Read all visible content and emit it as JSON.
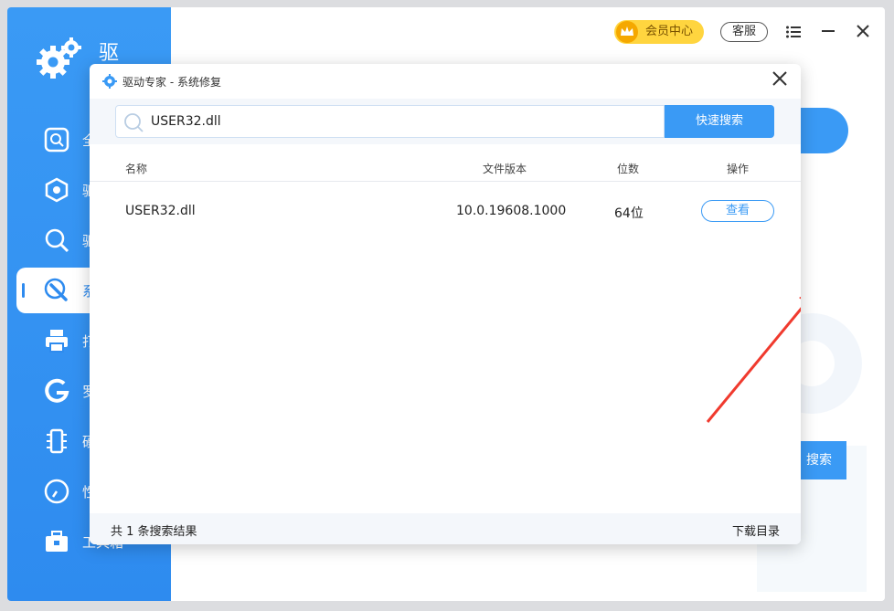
{
  "app": {
    "brand_name": "驱动",
    "vip_label": "会员中心",
    "service_label": "客服",
    "menu_icon": "hamburger-icon",
    "minimize_icon": "minimize-icon",
    "close_icon": "close-icon"
  },
  "sidebar": {
    "items": [
      {
        "label": "全",
        "icon": "scan-icon"
      },
      {
        "label": "驱",
        "icon": "hex-nut-icon"
      },
      {
        "label": "驱",
        "icon": "magnifier-icon"
      },
      {
        "label": "系",
        "icon": "wrench-icon",
        "active": true
      },
      {
        "label": "打",
        "icon": "printer-icon"
      },
      {
        "label": "罗",
        "icon": "logitech-icon"
      },
      {
        "label": "硬",
        "icon": "memory-chip-icon"
      },
      {
        "label": "性",
        "icon": "gauge-icon"
      },
      {
        "label": "工具箱",
        "icon": "toolbox-icon"
      }
    ]
  },
  "background": {
    "search_button_fragment": "搜索"
  },
  "dialog": {
    "title": "驱动专家 - 系统修复",
    "search": {
      "value": "USER32.dll",
      "button_label": "快速搜索"
    },
    "table": {
      "headers": {
        "name": "名称",
        "version": "文件版本",
        "bits": "位数",
        "action": "操作"
      },
      "rows": [
        {
          "name": "USER32.dll",
          "version": "10.0.19608.1000",
          "bits": "64位",
          "action": "查看"
        }
      ]
    },
    "footer": {
      "result_count": "共 1 条搜索结果",
      "download_dir": "下载目录"
    }
  },
  "colors": {
    "primary": "#3a9af5",
    "sidebar": "#2e8bef",
    "vip": "#ffd53f",
    "annotation_arrow": "#f03a2e"
  }
}
